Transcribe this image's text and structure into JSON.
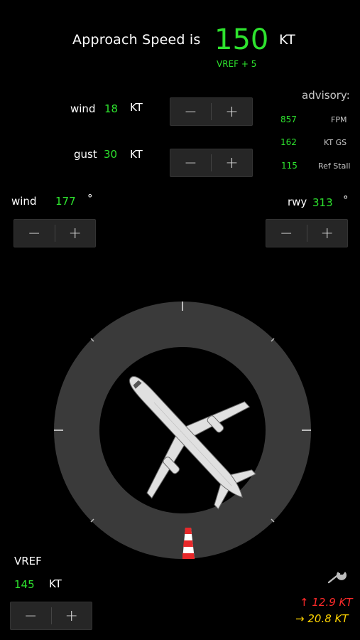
{
  "header": {
    "label": "Approach Speed is",
    "speed": "150",
    "unit": "KT",
    "vref_offset": "VREF + 5"
  },
  "wind_speed": {
    "label": "wind",
    "value": "18",
    "unit": "KT"
  },
  "gust": {
    "label": "gust",
    "value": "30",
    "unit": "KT"
  },
  "advisory": {
    "title": "advisory:",
    "rows": [
      {
        "value": "857",
        "label": "FPM"
      },
      {
        "value": "162",
        "label": "KT GS"
      },
      {
        "value": "115",
        "label": "Ref Stall"
      }
    ]
  },
  "wind_dir": {
    "label": "wind",
    "value": "177",
    "unit": "°"
  },
  "runway": {
    "label": "rwy",
    "value": "313",
    "unit": "°"
  },
  "vref": {
    "label": "VREF",
    "value": "145",
    "unit": "KT"
  },
  "components": {
    "headwind_arrow": "↑",
    "headwind": "12.9 KT",
    "crosswind_arrow": "→",
    "crosswind": "20.8 KT"
  },
  "stepper": {
    "minus": "−",
    "plus": "+"
  },
  "colors": {
    "accent": "#2ee32e",
    "headwind": "#ff2a2a",
    "crosswind": "#ffd400",
    "ring": "#3a3a3a"
  },
  "icons": {
    "settings": "wrench-icon",
    "aircraft": "airplane-icon",
    "runway_marker": "runway-cone-icon"
  }
}
